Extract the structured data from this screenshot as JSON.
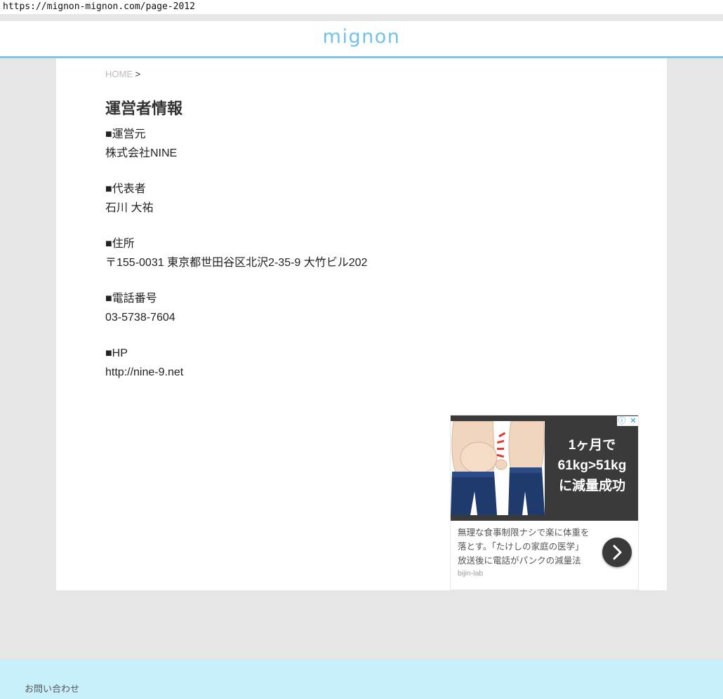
{
  "browser": {
    "url": "https://mignon-mignon.com/page-2012"
  },
  "header": {
    "logo": "mignon",
    "logo_color": "#6fc3e6",
    "accent_color": "#7ec8e3"
  },
  "breadcrumb": {
    "home": "HOME",
    "separator": ">"
  },
  "page": {
    "title": "運営者情報",
    "sections": [
      {
        "label": "■運営元",
        "value": "株式会社NINE"
      },
      {
        "label": "■代表者",
        "value": "石川 大祐"
      },
      {
        "label": "■住所",
        "value": "〒155-0031 東京都世田谷区北沢2-35-9 大竹ビル202"
      },
      {
        "label": "■電話番号",
        "value": "03-5738-7604"
      },
      {
        "label": "■HP",
        "value": "http://nine-9.net"
      }
    ]
  },
  "ad": {
    "headline": [
      "1ヶ月で",
      "61kg>51kg",
      "に減量成功"
    ],
    "text": [
      "無理な食事制限ナシで楽に体重を",
      "落とす。「たけしの家庭の医学」",
      "放送後に電話がパンクの減量法"
    ],
    "source": "bijin-lab",
    "badges": {
      "info_icon": "info-icon",
      "close_icon": "close-icon"
    }
  },
  "footer": {
    "link": "お問い合わせ",
    "color": "#c8f0fc"
  }
}
